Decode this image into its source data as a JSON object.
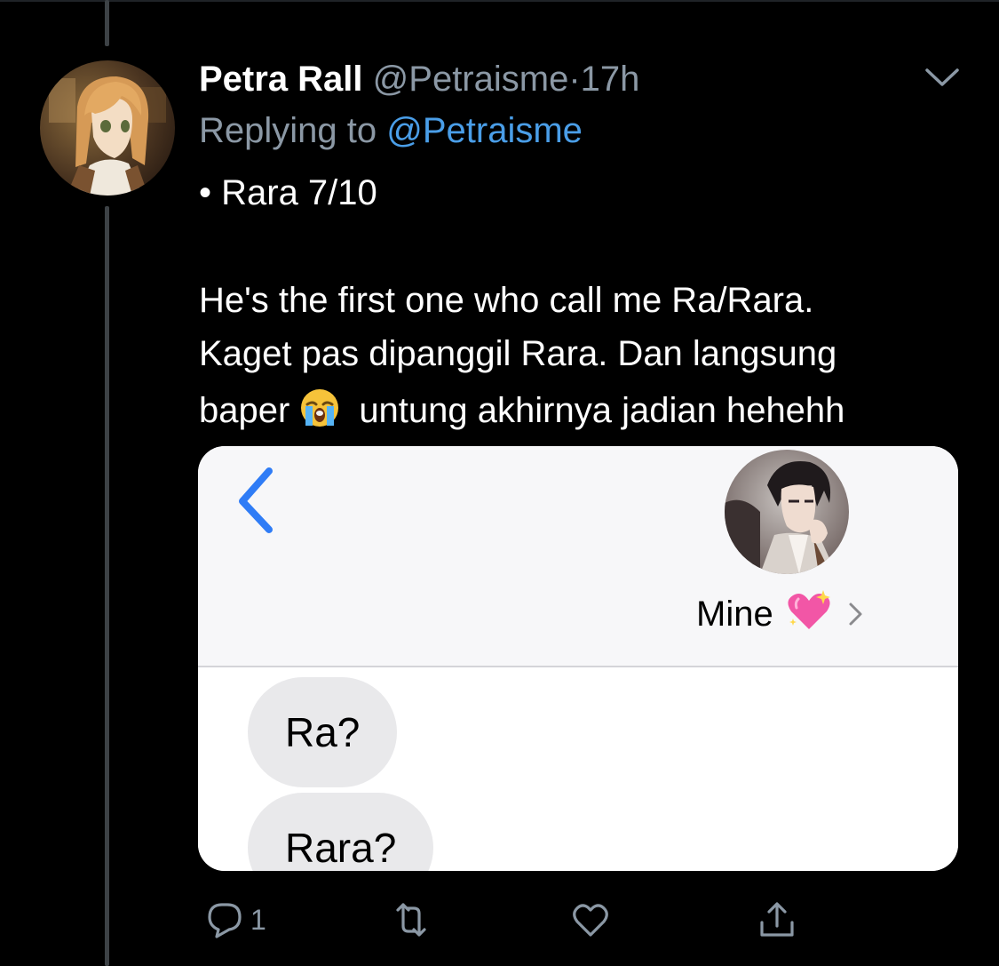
{
  "tweet": {
    "author_name": "Petra Rall",
    "author_handle": "@Petraisme",
    "separator": "·",
    "time": "17h",
    "replying_prefix": "Replying to",
    "replying_handle": "@Petraisme",
    "lines": [
      "• Rara 7/10",
      "He's the first one who call me Ra/Rara.",
      "Kaget pas dipanggil Rara. Dan langsung",
      "baper",
      "untung akhirnya jadian hehehh"
    ]
  },
  "media": {
    "contact_name": "Mine",
    "messages": [
      "Ra?",
      "Rara?"
    ]
  },
  "actions": {
    "reply_count": "1"
  },
  "colors": {
    "background": "#000000",
    "muted_text": "#8b98a5",
    "mention": "#4a9ee8",
    "ios_blue": "#2f7cf6",
    "bubble": "#e9e9eb"
  },
  "icons": {
    "caret": "chevron-down-icon",
    "reply": "comment-icon",
    "retweet": "retweet-icon",
    "like": "heart-icon",
    "share": "share-icon",
    "back": "chevron-left-icon",
    "crying_emoji": "loudly-crying-face-emoji",
    "heart_emoji": "sparkling-heart-emoji"
  }
}
